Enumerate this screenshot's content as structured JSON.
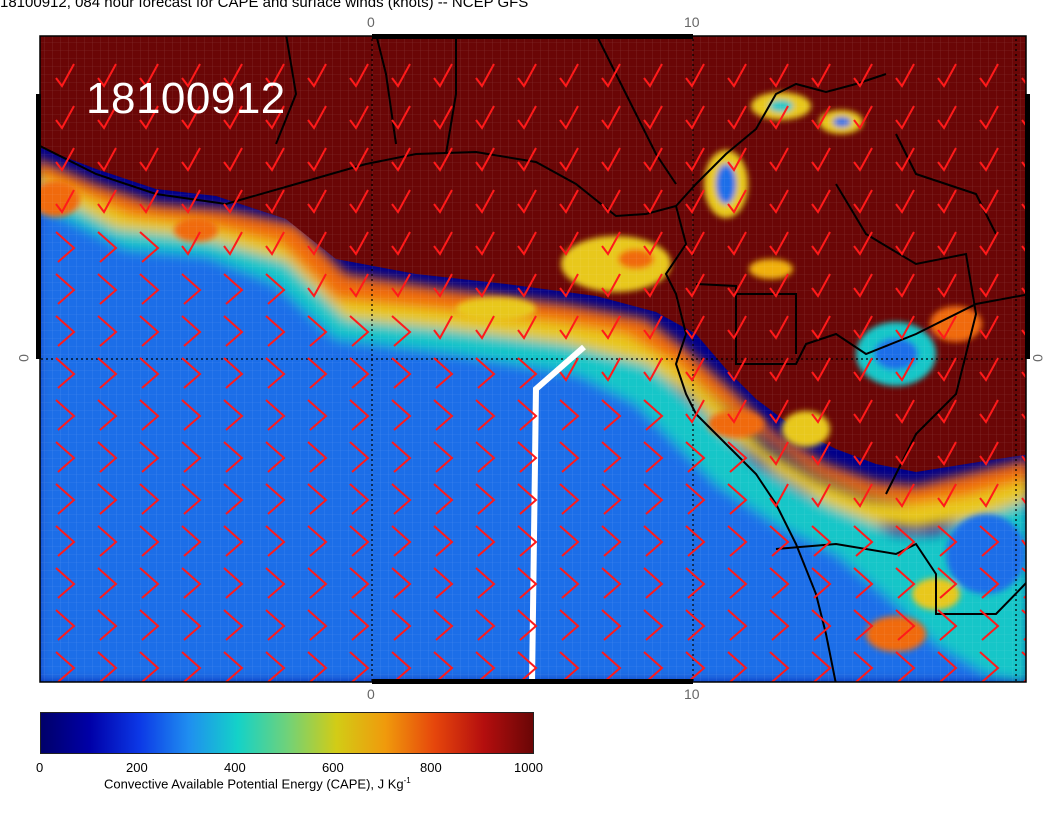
{
  "header": {
    "title": "18100912, 084 hour forecast for CAPE and surface winds (knots) -- NCEP GFS"
  },
  "map": {
    "stamp": "18100912",
    "ticks": {
      "top": [
        "0",
        "10"
      ],
      "bottom": [
        "0",
        "10"
      ],
      "left": "0",
      "right": "0"
    },
    "colors": {
      "land_high_cape": "#6a0606",
      "ocean_low_cape": "#00008a",
      "wind_barbs": "#ff1a1a",
      "boundaries": "#000000",
      "section_line": "#ffffff"
    }
  },
  "colorbar": {
    "labels": [
      "0",
      "200",
      "400",
      "600",
      "800",
      "1000"
    ],
    "title": "Convective Available Potential Energy (CAPE), J Kg",
    "title_sup": "-1"
  }
}
